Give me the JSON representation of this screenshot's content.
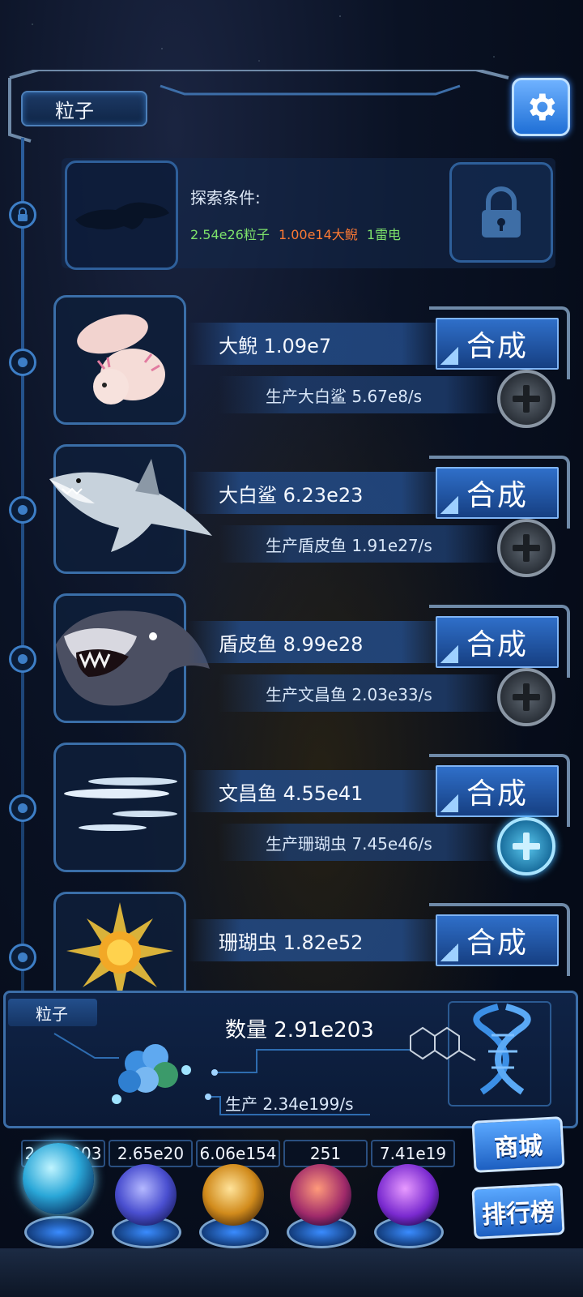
{
  "header": {
    "title": "粒子"
  },
  "locked": {
    "condition_label": "探索条件:",
    "requirements": [
      {
        "text": "2.54e26粒子",
        "color": "#7ee36b"
      },
      {
        "text": "1.00e14大鲵",
        "color": "#ff7a33"
      },
      {
        "text": "1雷电",
        "color": "#7ee36b"
      }
    ]
  },
  "creatures": [
    {
      "name_line": "大鲵 1.09e7",
      "merge_label": "合成",
      "produce_line": "生产大白鲨 5.67e8/s",
      "plus_active": false
    },
    {
      "name_line": "大白鲨 6.23e23",
      "merge_label": "合成",
      "produce_line": "生产盾皮鱼 1.91e27/s",
      "plus_active": false
    },
    {
      "name_line": "盾皮鱼 8.99e28",
      "merge_label": "合成",
      "produce_line": "生产文昌鱼 2.03e33/s",
      "plus_active": false
    },
    {
      "name_line": "文昌鱼 4.55e41",
      "merge_label": "合成",
      "produce_line": "生产珊瑚虫 7.45e46/s",
      "plus_active": true
    },
    {
      "name_line": "珊瑚虫 1.82e52",
      "merge_label": "合成",
      "produce_line": "",
      "plus_active": false
    }
  ],
  "summary": {
    "tag": "粒子",
    "quantity": "数量 2.91e203",
    "production": "生产 2.34e199/s"
  },
  "resources": [
    "2.91e203",
    "2.65e20",
    "6.06e154",
    "251",
    "7.41e19"
  ],
  "side_buttons": {
    "shop": "商城",
    "ranking": "排行榜"
  }
}
